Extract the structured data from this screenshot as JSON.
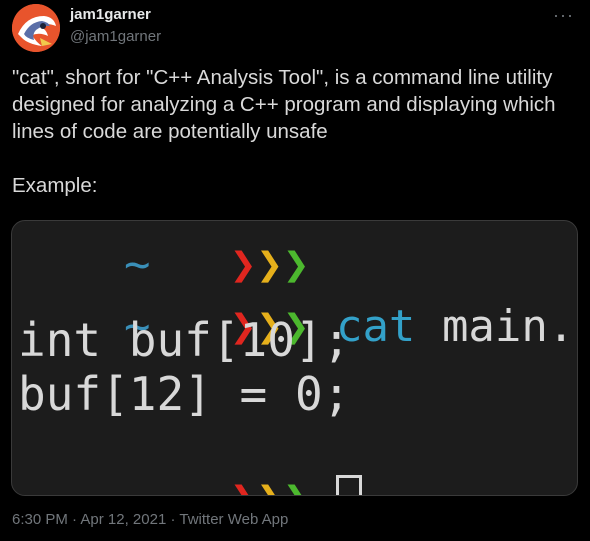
{
  "user": {
    "display_name": "jam1garner",
    "handle": "@jam1garner"
  },
  "more_icon": "more-horizontal-icon",
  "more_label": "···",
  "tweet": {
    "text": "\"cat\", short for \"C++ Analysis Tool\", is a command line utility designed for analyzing a C++ program and displaying which lines of code are potentially unsafe\n\nExample:"
  },
  "terminal": {
    "colors": {
      "background": "#1c1c1c",
      "tilde": "#3a8fb8",
      "chevron_1": "#e0261f",
      "chevron_2": "#e6b01b",
      "chevron_3": "#4cb82e",
      "command": "#33a1c9",
      "text": "#d8d8d8"
    },
    "prompt_tilde": "~",
    "prompt_chevrons": [
      "❯",
      "❯",
      "❯"
    ],
    "command": "cat",
    "argument": "main.cpp",
    "output_lines": [
      "int buf[10];",
      "buf[12] = 0;"
    ]
  },
  "meta": {
    "time": "6:30 PM",
    "separator": "·",
    "date": "Apr 12, 2021",
    "source": "Twitter Web App"
  }
}
